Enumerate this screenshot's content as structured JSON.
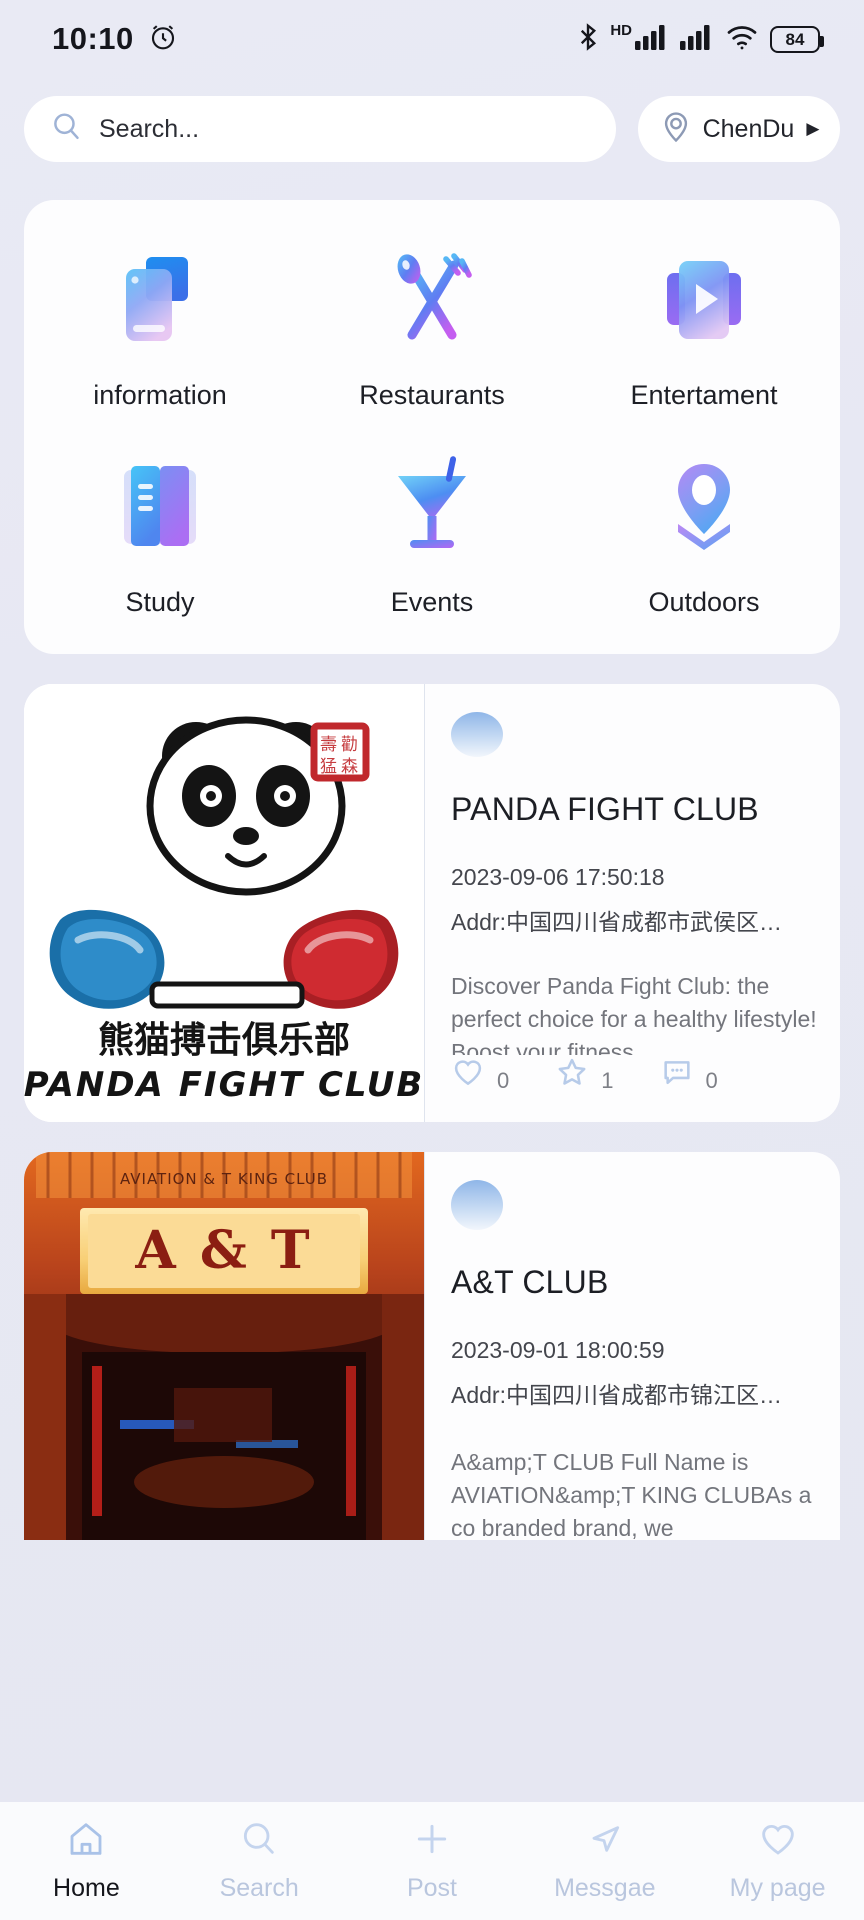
{
  "status_bar": {
    "time": "10:10",
    "alarm_icon": "alarm-icon",
    "bluetooth_icon": "bluetooth-icon",
    "hd_label": "HD",
    "signal_icon": "signal-icon",
    "wifi_icon": "wifi-icon",
    "battery_level": "84"
  },
  "search": {
    "placeholder": "Search...",
    "value": "",
    "icon": "search-icon"
  },
  "location": {
    "label": "ChenDu",
    "icon": "location-target-icon",
    "caret": "▶"
  },
  "categories": [
    {
      "label": "information",
      "icon": "news-card-icon"
    },
    {
      "label": "Restaurants",
      "icon": "spoon-fork-icon"
    },
    {
      "label": "Entertament",
      "icon": "video-play-icon"
    },
    {
      "label": "Study",
      "icon": "book-icon"
    },
    {
      "label": "Events",
      "icon": "cocktail-glass-icon"
    },
    {
      "label": "Outdoors",
      "icon": "map-pin-icon"
    }
  ],
  "feed": [
    {
      "title": "PANDA FIGHT CLUB",
      "date": "2023-09-06 17:50:18",
      "address": "Addr:中国四川省成都市武侯区…",
      "description": "Discover Panda Fight Club: the perfect choice for a healthy lifestyle! Boost your fitness,",
      "image_alt": "panda-fight-club-logo",
      "image_caption_cn": "熊猫搏击俱乐部",
      "image_caption_en": "PANDA FIGHT CLUB",
      "likes": "0",
      "stars": "1",
      "comments": "0"
    },
    {
      "title": "A&T CLUB",
      "date": "2023-09-01 18:00:59",
      "address": "Addr:中国四川省成都市锦江区…",
      "description": "A&amp;T CLUB Full Name is AVIATION&amp;T KING CLUBAs a co branded brand, we",
      "image_alt": "aviation-t-king-club-entrance",
      "image_sign_top": "AVIATION & T KING CLUB",
      "image_sign_main": "A & T",
      "likes": "",
      "stars": "",
      "comments": ""
    }
  ],
  "bottom_nav": [
    {
      "label": "Home",
      "icon": "home-icon",
      "active": true
    },
    {
      "label": "Search",
      "icon": "search-icon",
      "active": false
    },
    {
      "label": "Post",
      "icon": "plus-icon",
      "active": false
    },
    {
      "label": "Messgae",
      "icon": "send-paper-plane-icon",
      "active": false
    },
    {
      "label": "My page",
      "icon": "heart-icon",
      "active": false
    }
  ],
  "colors": {
    "background": "#e8e9f3",
    "card": "#fdfdfe",
    "accent_blue": "#4a7fe8",
    "accent_purple": "#9b6ef3",
    "muted_icon": "#c4d2ec",
    "text_primary": "#1c1e24",
    "text_secondary": "#73757c"
  }
}
